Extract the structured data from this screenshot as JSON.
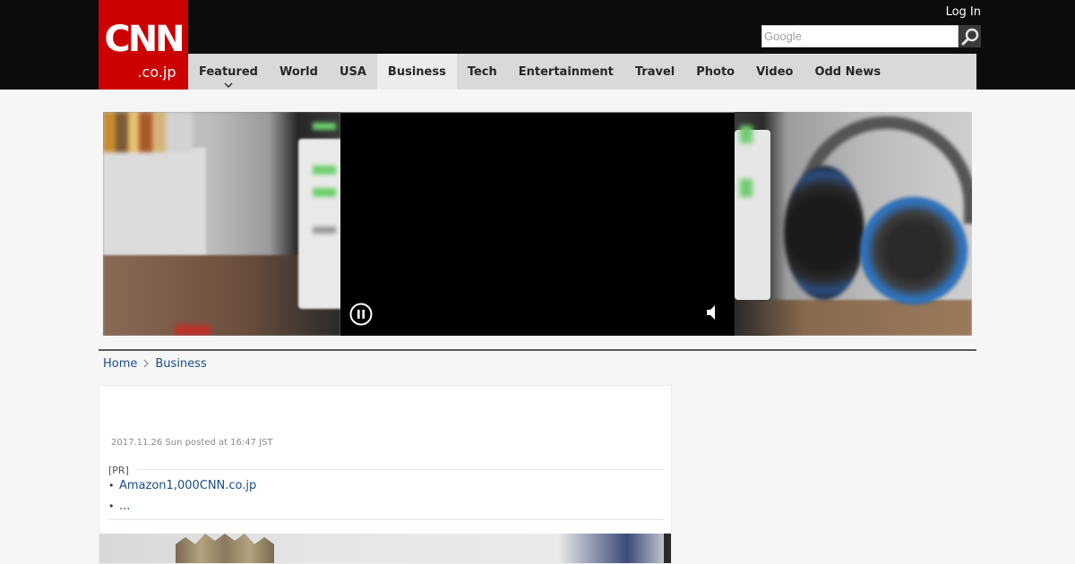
{
  "header": {
    "logo": {
      "line1": "CNN",
      "line2": ".co.jp"
    },
    "login_label": "Log In",
    "search": {
      "placeholder": "Google"
    }
  },
  "nav": {
    "items": [
      {
        "label": "Featured",
        "has_dropdown": true
      },
      {
        "label": "World"
      },
      {
        "label": "USA"
      },
      {
        "label": "Business",
        "active": true
      },
      {
        "label": "Tech"
      },
      {
        "label": "Entertainment"
      },
      {
        "label": "Travel"
      },
      {
        "label": "Photo"
      },
      {
        "label": "Video"
      },
      {
        "label": "Odd News"
      }
    ]
  },
  "video": {
    "controls": [
      "pause-icon",
      "volume-icon"
    ]
  },
  "breadcrumb": [
    {
      "label": "Home"
    },
    {
      "label": "Business"
    }
  ],
  "article": {
    "posted": "2017.11.26 Sun posted at 16:47 JST",
    "pr_label": "[PR]",
    "pr_links": [
      {
        "label": "Amazon1,000CNN.co.jp"
      },
      {
        "label": "..."
      }
    ]
  },
  "colors": {
    "brand_red": "#cc0000",
    "header_bg": "#0c0c0c",
    "nav_bg": "#d9d9d9",
    "link": "#1a4c8a"
  }
}
